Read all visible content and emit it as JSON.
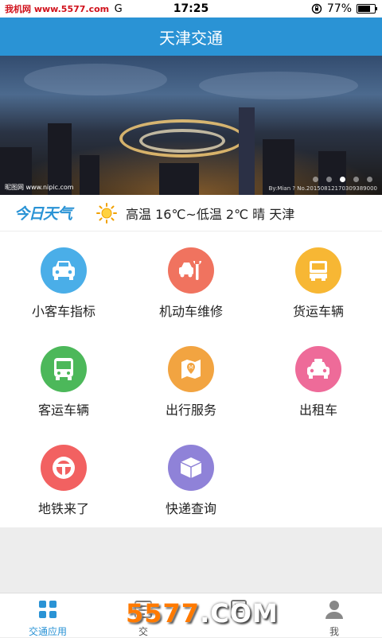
{
  "status_bar": {
    "brand": "我机网 www.5577.com",
    "network": "G",
    "time": "17:25",
    "battery_percent": "77%",
    "battery_level": 0.77
  },
  "header": {
    "title": "天津交通"
  },
  "banner": {
    "watermark_left": "昵图网 www.nipic.com",
    "watermark_right": "By:Mian ? No.20150812170309389000",
    "page_count": 5,
    "active_page": 3
  },
  "weather": {
    "logo": "今日天气",
    "icon": "sun-icon",
    "text": "高温 16℃~低温 2℃  晴  天津"
  },
  "services": [
    {
      "label": "小客车指标",
      "icon": "car-icon",
      "color": "#4aaee8"
    },
    {
      "label": "机动车维修",
      "icon": "wrench-icon",
      "color": "#f0735f"
    },
    {
      "label": "货运车辆",
      "icon": "truck-icon",
      "color": "#f7b734"
    },
    {
      "label": "客运车辆",
      "icon": "bus-icon",
      "color": "#4cb85a"
    },
    {
      "label": "出行服务",
      "icon": "map-icon",
      "color": "#f2a441"
    },
    {
      "label": "出租车",
      "icon": "taxi-icon",
      "color": "#ee6b99"
    },
    {
      "label": "地铁来了",
      "icon": "metro-icon",
      "color": "#f26161"
    },
    {
      "label": "快递查询",
      "icon": "package-icon",
      "color": "#8f82d8"
    }
  ],
  "tabs": [
    {
      "label": "交通应用",
      "icon": "grid-icon",
      "active": true
    },
    {
      "label": "交",
      "icon": "news-icon",
      "active": false
    },
    {
      "label": "",
      "icon": "document-icon",
      "active": false
    },
    {
      "label": "我",
      "icon": "person-icon",
      "active": false
    }
  ],
  "watermark": {
    "prefix": "5577",
    "suffix": ".COM"
  },
  "colors": {
    "primary": "#2a93d5",
    "background": "#ededed"
  }
}
